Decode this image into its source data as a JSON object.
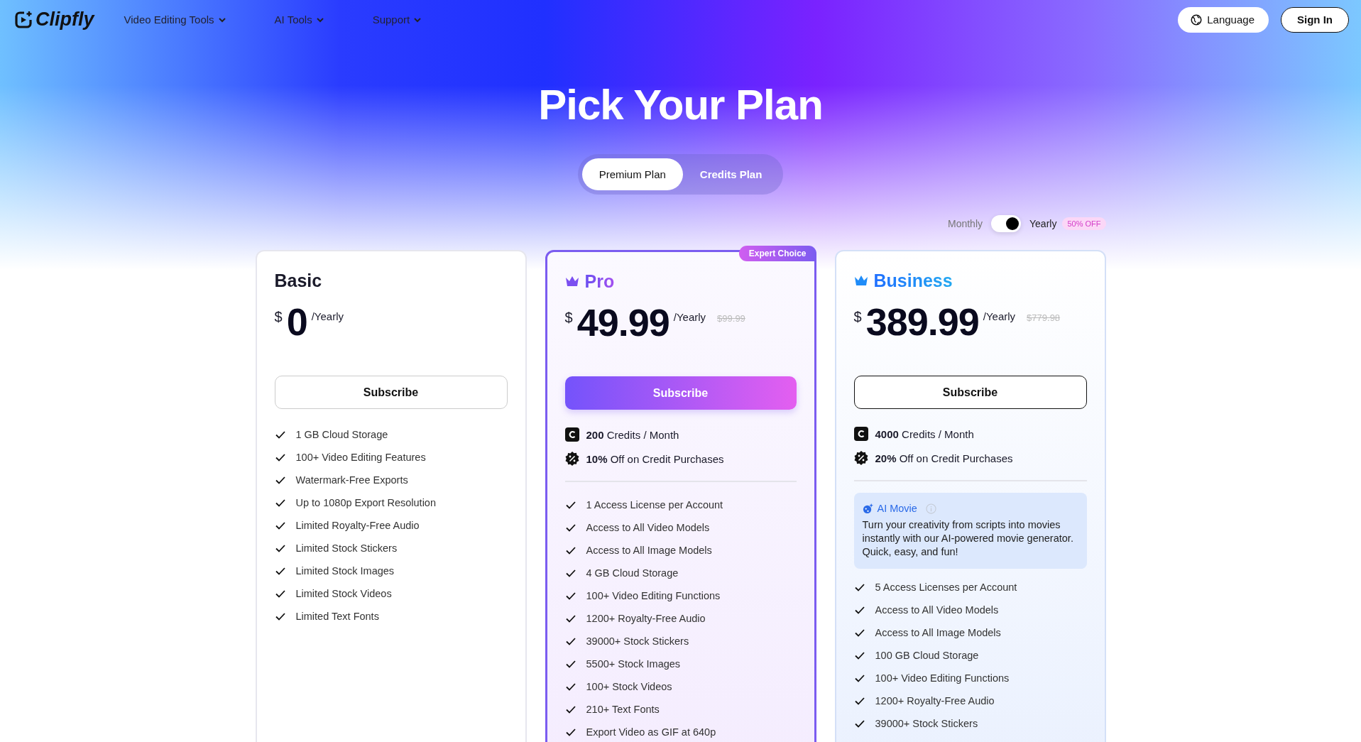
{
  "header": {
    "logo": "Clipfly",
    "nav": [
      {
        "label": "Video Editing Tools"
      },
      {
        "label": "AI Tools"
      },
      {
        "label": "Support"
      }
    ],
    "language_button": "Language",
    "sign_in_button": "Sign In"
  },
  "hero": {
    "title": "Pick Your Plan"
  },
  "plan_tabs": [
    {
      "label": "Premium Plan",
      "selected": true
    },
    {
      "label": "Credits Plan",
      "selected": false
    }
  ],
  "billing": {
    "monthly_label": "Monthly",
    "yearly_label": "Yearly",
    "yearly_selected": true,
    "badge": "50% OFF"
  },
  "cards": [
    {
      "kind": "basic",
      "name": "Basic",
      "currency": "$",
      "amount": "0",
      "period": "/Yearly",
      "button": "Subscribe",
      "features": [
        "1 GB Cloud Storage",
        "100+ Video Editing Features",
        "Watermark-Free Exports",
        "Up to 1080p Export Resolution",
        "Limited Royalty-Free Audio",
        "Limited Stock Stickers",
        "Limited Stock Images",
        "Limited Stock Videos",
        "Limited Text Fonts"
      ]
    },
    {
      "kind": "pro",
      "name": "Pro",
      "badge": "Expert Choice",
      "currency": "$",
      "amount": "49.99",
      "period": "/Yearly",
      "original_price": "$99.99",
      "button": "Subscribe",
      "credits": "**200** Credits / Month",
      "discount": "**10%** Off on Credit Purchases",
      "features": [
        "1 Access License per Account",
        "Access to All Video Models",
        "Access to All Image Models",
        "4 GB Cloud Storage",
        "100+ Video Editing Functions",
        "1200+ Royalty-Free Audio",
        "39000+ Stock Stickers",
        "5500+ Stock Images",
        "100+ Stock Videos",
        "210+ Text Fonts",
        "Export Video as GIF at 640p"
      ]
    },
    {
      "kind": "business",
      "name": "Business",
      "currency": "$",
      "amount": "389.99",
      "period": "/Yearly",
      "original_price": "$779.98",
      "button": "Subscribe",
      "credits": "**4000** Credits / Month",
      "discount": "**20%** Off on Credit Purchases",
      "highlight": {
        "title": "AI Movie",
        "text": "Turn your creativity from scripts into movies instantly with our AI-powered movie generator. Quick, easy, and fun!"
      },
      "features": [
        "5 Access Licenses per Account",
        "Access to All Video Models",
        "Access to All Image Models",
        "100 GB Cloud Storage",
        "100+ Video Editing Functions",
        "1200+ Royalty-Free Audio",
        "39000+ Stock Stickers"
      ]
    }
  ]
}
